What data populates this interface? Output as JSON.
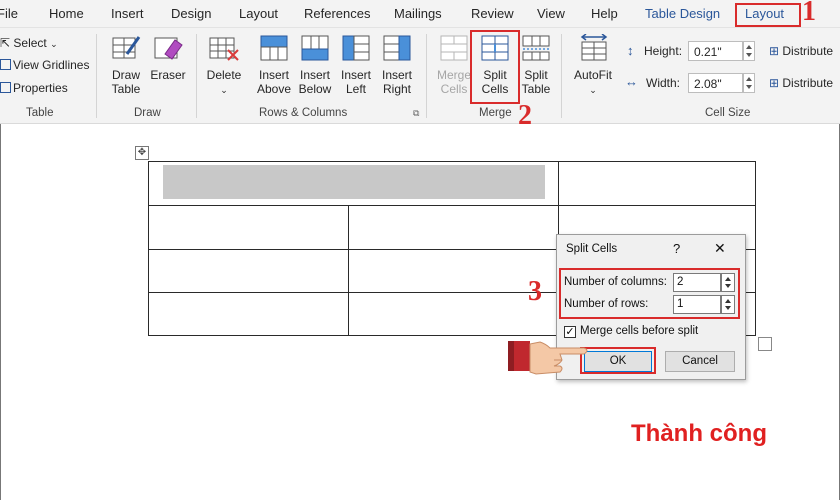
{
  "menu": {
    "tabs": [
      "File",
      "Home",
      "Insert",
      "Design",
      "Layout",
      "References",
      "Mailings",
      "Review",
      "View",
      "Help",
      "Table Design",
      "Layout"
    ]
  },
  "ribbon": {
    "table_group": {
      "select": "Select",
      "view_gridlines": "View Gridlines",
      "properties": "Properties",
      "label": "Table"
    },
    "draw_group": {
      "draw_table_1": "Draw",
      "draw_table_2": "Table",
      "eraser": "Eraser",
      "label": "Draw"
    },
    "rows_cols_group": {
      "delete": "Delete",
      "insert_above_1": "Insert",
      "insert_above_2": "Above",
      "insert_below_1": "Insert",
      "insert_below_2": "Below",
      "insert_left_1": "Insert",
      "insert_left_2": "Left",
      "insert_right_1": "Insert",
      "insert_right_2": "Right",
      "label": "Rows & Columns"
    },
    "merge_group": {
      "merge_cells_1": "Merge",
      "merge_cells_2": "Cells",
      "split_cells_1": "Split",
      "split_cells_2": "Cells",
      "split_table_1": "Split",
      "split_table_2": "Table",
      "label": "Merge"
    },
    "cell_size_group": {
      "autofit": "AutoFit",
      "height_label": "Height:",
      "height_value": "0.21\"",
      "width_label": "Width:",
      "width_value": "2.08\"",
      "distribute_rows": "Distribute",
      "distribute_cols": "Distribute",
      "label": "Cell Size"
    }
  },
  "annotations": {
    "step1": "1",
    "step2": "2",
    "step3": "3",
    "result": "Thành công"
  },
  "dialog": {
    "title": "Split Cells",
    "help": "?",
    "close": "✕",
    "columns_label": "Number of columns:",
    "columns_value": "2",
    "rows_label": "Number of rows:",
    "rows_value": "1",
    "merge_label": "Merge cells before split",
    "merge_checked": true,
    "ok": "OK",
    "cancel": "Cancel"
  },
  "colors": {
    "accent": "#2b579a",
    "highlight": "#d92b2b",
    "result": "#e02020"
  }
}
